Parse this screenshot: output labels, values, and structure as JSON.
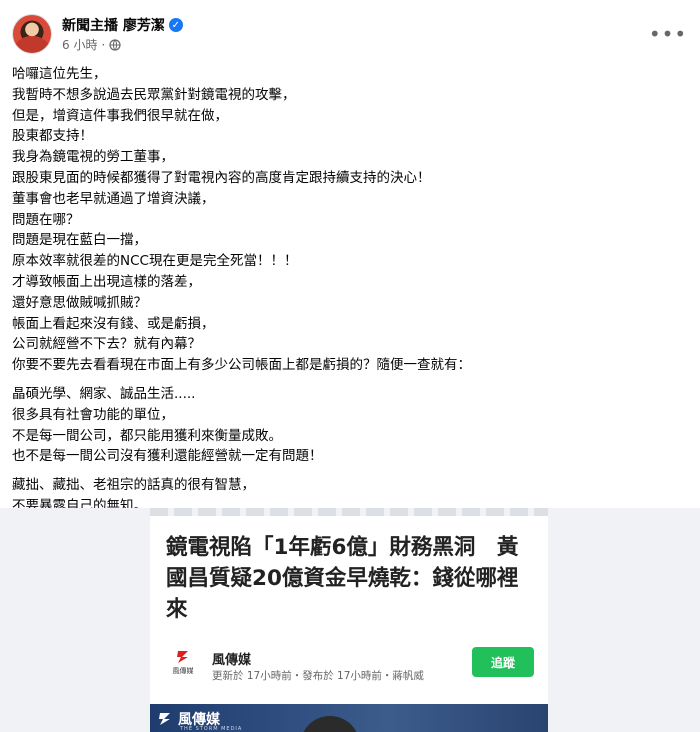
{
  "header": {
    "author_name": "新聞主播 廖芳潔",
    "timestamp": "6 小時",
    "separator": "·",
    "verified_icon": "verified-badge-icon",
    "privacy_icon": "globe-icon",
    "more_icon": "more-horizontal-icon"
  },
  "post": {
    "paragraphs": [
      [
        "哈囉這位先生，",
        "我暫時不想多說過去民眾黨針對鏡電視的攻擊，",
        "但是，增資這件事我們很早就在做，",
        "股東都支持！",
        "我身為鏡電視的勞工董事，",
        "跟股東見面的時候都獲得了對電視內容的高度肯定跟持續支持的決心！",
        "董事會也老早就通過了增資決議，",
        "問題在哪？",
        "問題是現在藍白一擋，",
        "原本效率就很差的NCC現在更是完全死當！！！",
        "才導致帳面上出現這樣的落差，",
        "還好意思做賊喊抓賊？",
        "帳面上看起來沒有錢、或是虧損，",
        "公司就經營不下去？就有內幕？",
        "你要不要先去看看現在市面上有多少公司帳面上都是虧損的？隨便一查就有："
      ],
      [
        "晶碩光學、網家、誠品生活.....",
        "很多具有社會功能的單位，",
        "不是每一間公司，都只能用獲利來衡量成敗。",
        "也不是每一間公司沒有獲利還能經營就一定有問題！"
      ],
      [
        "藏拙、藏拙、老祖宗的話真的很有智慧，",
        "不要暴露自己的無知。"
      ]
    ]
  },
  "preview": {
    "article_title": "鏡電視陷「1年虧6億」財務黑洞　黃國昌質疑20億資金早燒乾：錢從哪裡來",
    "source_name": "風傳媒",
    "source_logo_label": "風傳媒",
    "source_meta": "更新於 17小時前・發布於 17小時前・蔣帆威",
    "follow_label": "追蹤",
    "banner_text": "風傳媒",
    "banner_sub": "THE STORM MEDIA",
    "colors": {
      "follow": "#21c05a",
      "banner": "#1f3c6e",
      "brand_red": "#e02020"
    }
  }
}
